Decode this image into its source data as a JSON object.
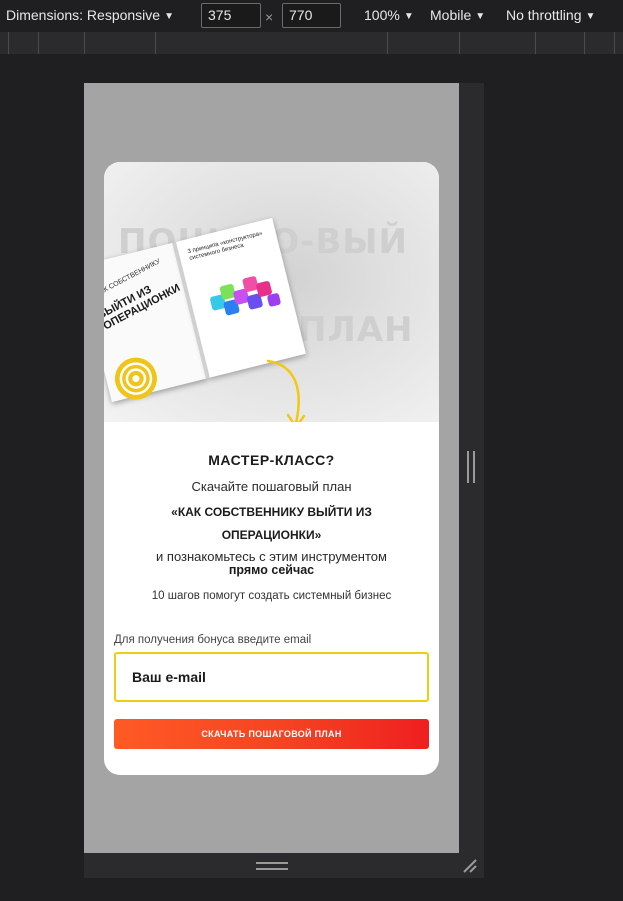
{
  "devtools": {
    "dimensions_label": "Dimensions: Responsive",
    "width_value": "375",
    "times": "×",
    "height_value": "770",
    "zoom": "100%",
    "device_mode": "Mobile",
    "throttling": "No throttling"
  },
  "hero": {
    "bg_word_1": "ПОШАГО-ВЫЙ",
    "bg_word_2": "ПЛАН",
    "book_small": "КАК СОБСТВЕННИКУ",
    "book_title": "ВЫЙТИ ИЗ ОПЕРАЦИОНКИ",
    "book_heading": "3 принципа «конструктора» системного бизнеса"
  },
  "modal": {
    "title": "МАСТЕР-КЛАСС?",
    "line1": "Скачайте пошаговый план",
    "line2": "«КАК СОБСТВЕННИКУ ВЫЙТИ ИЗ",
    "line3": "ОПЕРАЦИОНКИ»",
    "line4": "и познакомьтесь с этим инструментом",
    "line5": "прямо сейчас",
    "line6": "10 шагов помогут создать системный бизнес",
    "field_label": "Для получения бонуса введите email",
    "email_placeholder": "Ваш e-mail",
    "cta_label": "СКАЧАТЬ ПОШАГОВОЙ ПЛАН"
  },
  "colors": {
    "accent_yellow": "#f0cc16",
    "cta_start": "#ff5a24",
    "cta_end": "#ef1f1f",
    "overlay_gray": "#a4a4a4"
  }
}
